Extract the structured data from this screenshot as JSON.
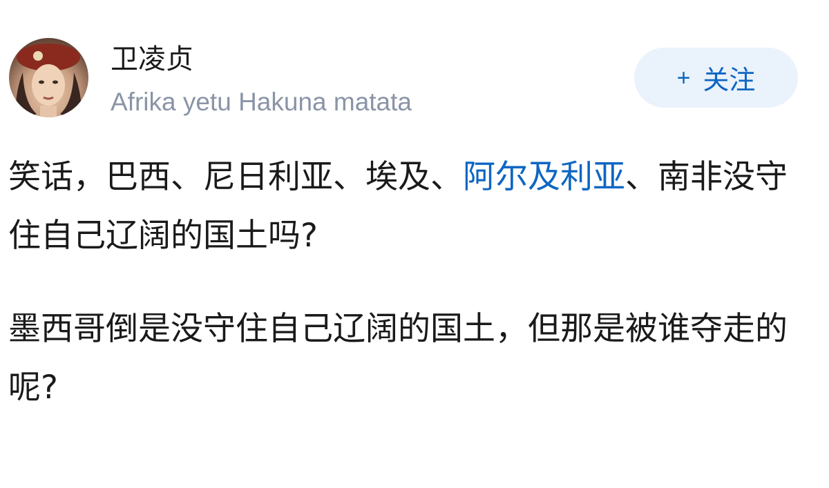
{
  "author": {
    "name": "卫凌贞",
    "bio": "Afrika yetu Hakuna matata",
    "avatar_icon": "avatar-photo"
  },
  "follow_button": {
    "icon": "+",
    "label": "关注",
    "color": "#0d66c2",
    "background": "#eaf2fb"
  },
  "post": {
    "paragraph1": {
      "before_link": "笑话，巴西、尼日利亚、埃及、",
      "link_text": "阿尔及利亚",
      "after_link": "、南非没守住自己辽阔的国土吗?"
    },
    "paragraph2": "墨西哥倒是没守住自己辽阔的国土，但那是被谁夺走的呢?"
  }
}
